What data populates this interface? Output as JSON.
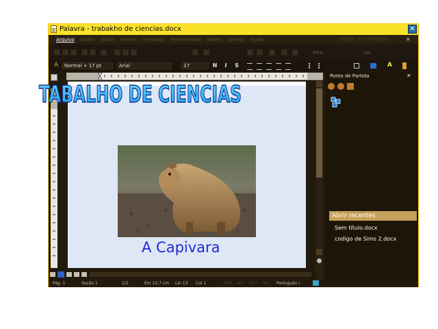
{
  "window": {
    "title": "Palavra  - trabakho de ciencias.docx",
    "close_glyph": "✕"
  },
  "menu": {
    "items": [
      "Arquivo",
      "Editar",
      "Exibir",
      "Inserir",
      "Formatar",
      "Ferramentas",
      "Tabela",
      "Janela",
      "Ajuda"
    ],
    "help_placeholder": "Digite uma pergunta"
  },
  "toolbar": {
    "zoom": "65%",
    "read_label": "Ler"
  },
  "format_bar": {
    "style": "Normal + 17 pt",
    "font": "Arial",
    "size": "17",
    "bold_label": "N",
    "italic_label": "I",
    "strike_label": "S"
  },
  "document": {
    "wordart_title": "TABALHO DE CIENCIAS",
    "caption": "A Capivara"
  },
  "task_pane": {
    "title": "Ponto de Partida",
    "recent_heading": "Abrir recentes",
    "recent_files": [
      "Sem título.docx",
      "codigo de Sims 2.docx"
    ]
  },
  "status_bar": {
    "page": "Pág. 1",
    "section": "Seção  1",
    "pages": "1/1",
    "position": "Em  10,7 cm",
    "line": "Lin  13",
    "column": "Col  1",
    "modes": [
      "GRA",
      "ALT",
      "EST",
      "SE"
    ],
    "language": "Português ("
  },
  "colors": {
    "title_bar": "#fbe22a",
    "chrome": "#231a0e",
    "page": "#dee7f5",
    "caption": "#1f29d4",
    "recent_header": "#c5a05a"
  }
}
